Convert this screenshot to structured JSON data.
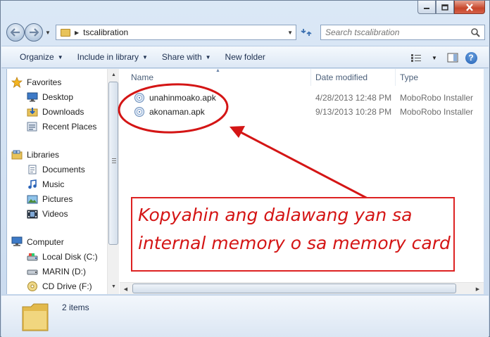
{
  "window": {
    "caption_buttons": [
      "minimize",
      "maximize",
      "close"
    ]
  },
  "address_bar": {
    "path": [
      "tscalibration"
    ]
  },
  "search": {
    "placeholder": "Search tscalibration"
  },
  "toolbar": {
    "organize": "Organize",
    "include": "Include in library",
    "share": "Share with",
    "new_folder": "New folder"
  },
  "navigation": {
    "favorites": {
      "label": "Favorites",
      "items": [
        {
          "label": "Desktop",
          "icon": "desktop-icon"
        },
        {
          "label": "Downloads",
          "icon": "downloads-icon"
        },
        {
          "label": "Recent Places",
          "icon": "recent-places-icon"
        }
      ]
    },
    "libraries": {
      "label": "Libraries",
      "items": [
        {
          "label": "Documents",
          "icon": "documents-icon"
        },
        {
          "label": "Music",
          "icon": "music-icon"
        },
        {
          "label": "Pictures",
          "icon": "pictures-icon"
        },
        {
          "label": "Videos",
          "icon": "videos-icon"
        }
      ]
    },
    "computer": {
      "label": "Computer",
      "items": [
        {
          "label": "Local Disk (C:)",
          "icon": "hard-disk-icon"
        },
        {
          "label": "MARIN (D:)",
          "icon": "drive-icon"
        },
        {
          "label": "CD Drive (F:)",
          "icon": "cd-drive-icon"
        }
      ]
    }
  },
  "columns": {
    "name": "Name",
    "date": "Date modified",
    "type": "Type"
  },
  "files": [
    {
      "name": "unahinmoako.apk",
      "date": "4/28/2013 12:48 PM",
      "type": "MoboRobo Installer"
    },
    {
      "name": "akonaman.apk",
      "date": "9/13/2013 10:28 PM",
      "type": "MoboRobo Installer"
    }
  ],
  "status": {
    "count": "2 items"
  },
  "annotation": {
    "line1": "Kopyahin ang dalawang yan sa",
    "line2": "internal memory o sa memory card",
    "color": "#d41515"
  }
}
